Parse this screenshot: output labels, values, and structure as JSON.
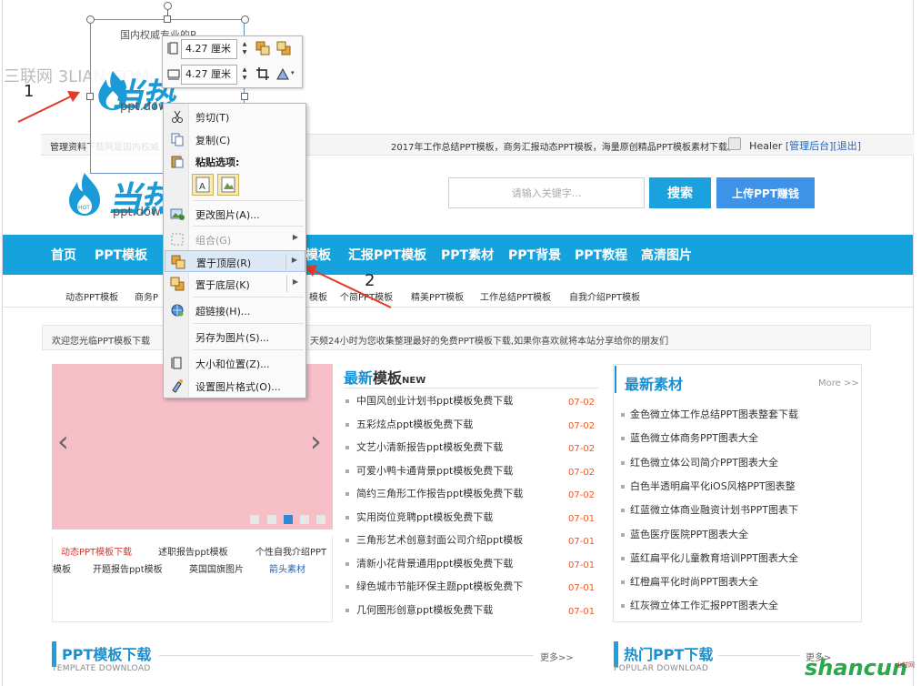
{
  "watermark": "三联网 3LIAN.COM",
  "annotations": {
    "one": "1",
    "two": "2"
  },
  "selected_image": {
    "caption": "国内权威专业的P"
  },
  "mini_toolbar": {
    "height_value": "4.27 厘米",
    "width_value": "4.27 厘米"
  },
  "context_menu": {
    "cut": "剪切(T)",
    "copy": "复制(C)",
    "paste_options": "粘贴选项:",
    "change_picture": "更改图片(A)...",
    "group": "组合(G)",
    "bring_to_front": "置于顶层(R)",
    "send_to_back": "置于底层(K)",
    "hyperlink": "超链接(H)...",
    "save_as_picture": "另存为图片(S)...",
    "size_position": "大小和位置(Z)...",
    "format_picture": "设置图片格式(O)..."
  },
  "topbar": {
    "text": "管理资料下载网是国内权威",
    "text_right": "2017年工作总结PPT模板，商务汇报动态PPT模板，海量原创精品PPT模板素材下载。",
    "user": "Healer",
    "admin": "[管理后台]",
    "logout": "[退出]"
  },
  "logo": {
    "word": "当热",
    "url": "ppt.dow"
  },
  "search": {
    "placeholder": "请输入关键字...",
    "button": "搜索",
    "upload": "上传PPT赚钱"
  },
  "nav": [
    "首页",
    "PPT模板",
    "模板",
    "汇报PPT模板",
    "PPT素材",
    "PPT背景",
    "PPT教程",
    "高清图片"
  ],
  "subnav": [
    "动态PPT模板",
    "商务P",
    "模板",
    "个简PPT模板",
    "精美PPT模板",
    "工作总结PPT模板",
    "自我介绍PPT模板"
  ],
  "welcome": {
    "left": "欢迎您光临PPT模板下载",
    "right": "天频24小时为您收集整理最好的免费PPT模板下载,如果你喜欢就将本站分享给你的朋友们"
  },
  "slider": {
    "prev": "‹",
    "next": "›"
  },
  "tags": [
    "动态PPT模板下载",
    "述职报告ppt模板",
    "个性自我介绍PPT",
    "模板",
    "开题报告ppt模板",
    "英国国旗图片",
    "箭头素材"
  ],
  "latest": {
    "title_a": "最新",
    "title_b": "模板",
    "title_new": "NEW",
    "items": [
      {
        "title": "中国风创业计划书ppt模板免费下载",
        "date": "07-02"
      },
      {
        "title": "五彩炫点ppt模板免费下载",
        "date": "07-02"
      },
      {
        "title": "文艺小清新报告ppt模板免费下载",
        "date": "07-02"
      },
      {
        "title": "可爱小鸭卡通背景ppt模板免费下载",
        "date": "07-02"
      },
      {
        "title": "简约三角形工作报告ppt模板免费下载",
        "date": "07-02"
      },
      {
        "title": "实用岗位竞聘ppt模板免费下载",
        "date": "07-01"
      },
      {
        "title": "三角形艺术创意封面公司介绍ppt模板",
        "date": "07-01"
      },
      {
        "title": "清新小花背景通用ppt模板免费下载",
        "date": "07-01"
      },
      {
        "title": "绿色城市节能环保主题ppt模板免费下",
        "date": "07-01"
      },
      {
        "title": "几何图形创意ppt模板免费下载",
        "date": "07-01"
      }
    ]
  },
  "materials": {
    "title": "最新素材",
    "more": "More >>",
    "items": [
      "金色微立体工作总结PPT图表整套下载",
      "蓝色微立体商务PPT图表大全",
      "红色微立体公司简介PPT图表大全",
      "白色半透明扁平化iOS风格PPT图表整",
      "红蓝微立体商业融资计划书PPT图表下",
      "蓝色医疗医院PPT图表大全",
      "蓝红扁平化儿童教育培训PPT图表大全",
      "红橙扁平化时尚PPT图表大全",
      "红灰微立体工作汇报PPT图表大全"
    ]
  },
  "sections": {
    "download_title": "PPT模板下载",
    "download_sub": "TEMPLATE DOWNLOAD",
    "download_more": "更多>>",
    "popular_title": "热门PPT下载",
    "popular_sub": "POPULAR DOWNLOAD",
    "popular_more": "更多>"
  },
  "brand": {
    "name": "shancun",
    "sub": "山村网"
  },
  "colors": {
    "accent": "#16a2dc",
    "slider_bg": "#f6bfc8",
    "date": "#e85a2a",
    "link": "#2266bb"
  }
}
